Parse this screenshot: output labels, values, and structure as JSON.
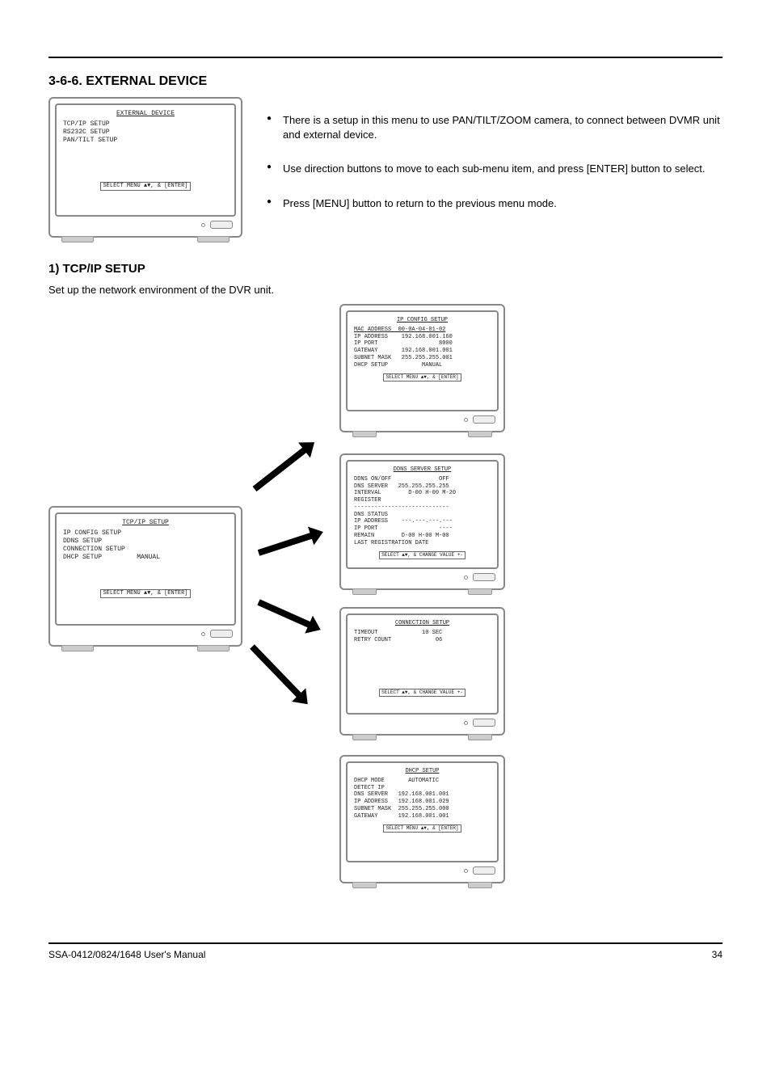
{
  "header_space": "",
  "section_title": "3-6-6. EXTERNAL DEVICE",
  "external_device_bullets": [
    "There is a setup in this menu to use PAN/TILT/ZOOM camera, to connect between DVMR unit and external device.",
    "Use direction buttons to move to each sub-menu item, and press [ENTER] button to select.",
    "Press [MENU] button to return to the previous menu mode."
  ],
  "crt_ext": {
    "title": "EXTERNAL DEVICE",
    "lines": [
      "TCP/IP SETUP",
      "RS232C SETUP",
      "PAN/TILT SETUP"
    ],
    "footer": "SELECT MENU ▲▼, & [ENTER]"
  },
  "tcpip_heading": "1) TCP/IP SETUP",
  "tcpip_desc": "Set up the network environment of the DVR unit.",
  "crt_tcpip": {
    "title": "TCP/IP SETUP",
    "lines": [
      "IP CONFIG SETUP",
      "DDNS SETUP",
      "CONNECTION SETUP",
      "DHCP SETUP         MANUAL"
    ],
    "footer": "SELECT MENU ▲▼, & [ENTER]"
  },
  "crt_ipconfig": {
    "title": "IP CONFIG SETUP",
    "mac": "MAC ADDRESS  00-0A-04-01-02",
    "lines": [
      "IP ADDRESS    192.168.001.160",
      "IP PORT                  8000",
      "GATEWAY       192.168.001.001",
      "SUBNET MASK   255.255.255.001",
      "",
      "DHCP SETUP          MANUAL"
    ],
    "footer": "SELECT MENU ▲▼, & [ENTER]"
  },
  "crt_ddns": {
    "title": "DDNS SERVER SETUP",
    "lines": [
      "DDNS ON/OFF              OFF",
      "DNS SERVER   255.255.255.255",
      "INTERVAL        D-00 H-00 M-20",
      "REGISTER",
      "----------------------------",
      "DNS STATUS",
      "IP ADDRESS    ---.---.---.---",
      "IP PORT                  ----",
      "REMAIN        D-00 H-00 M-00",
      "LAST REGISTRATION DATE"
    ],
    "footer": "SELECT ▲▼, & CHANGE VALUE +-"
  },
  "crt_conn": {
    "title": "CONNECTION SETUP",
    "lines": [
      "TIMEOUT             10 SEC",
      "RETRY COUNT             06"
    ],
    "footer": "SELECT ▲▼, & CHANGE VALUE +-"
  },
  "crt_dhcp": {
    "title": "DHCP SETUP",
    "lines": [
      "DHCP MODE       AUTOMATIC",
      "DETECT IP",
      "",
      "DNS SERVER   192.168.001.001",
      "IP ADDRESS   192.168.001.029",
      "SUBNET MASK  255.255.255.000",
      "GATEWAY      192.168.001.001"
    ],
    "footer": "SELECT MENU ▲▼, & [ENTER]"
  },
  "footer_left": "SSA-0412/0824/1648 User's Manual",
  "footer_right": "34"
}
